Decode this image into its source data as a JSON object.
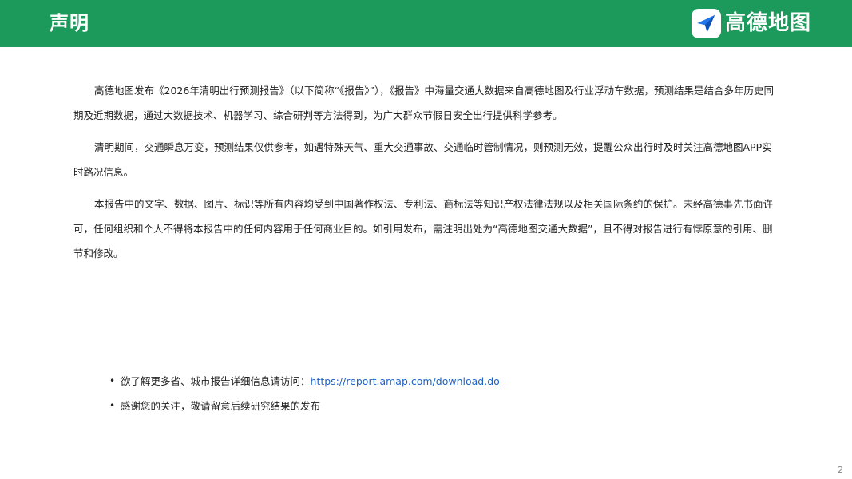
{
  "header": {
    "title": "声明",
    "logo_text": "高德地图",
    "background_color": "#1c9a5b",
    "logo_icon": "paper-plane-icon"
  },
  "paragraphs": [
    "高德地图发布《2026年清明出行预测报告》（以下简称“《报告》”），《报告》中海量交通大数据来自高德地图及行业浮动车数据，预测结果是结合多年历史同期及近期数据，通过大数据技术、机器学习、综合研判等方法得到，为广大群众节假日安全出行提供科学参考。",
    "清明期间，交通瞬息万变，预测结果仅供参考，如遇特殊天气、重大交通事故、交通临时管制情况，则预测无效，提醒公众出行时及时关注高德地图APP实时路况信息。",
    "本报告中的文字、数据、图片、标识等所有内容均受到中国著作权法、专利法、商标法等知识产权法律法规以及相关国际条约的保护。未经高德事先书面许可，任何组织和个人不得将本报告中的任何内容用于任何商业目的。如引用发布，需注明出处为“高德地图交通大数据”，且不得对报告进行有悖原意的引用、删节和修改。"
  ],
  "links": {
    "item1_text": "欲了解更多省、城市报告详细信息请访问：",
    "item1_url": "https://report.amap.com/download.do",
    "item2_text": "感谢您的关注，敬请留意后续研究结果的发布",
    "bullet": "•"
  },
  "page_number": "2"
}
